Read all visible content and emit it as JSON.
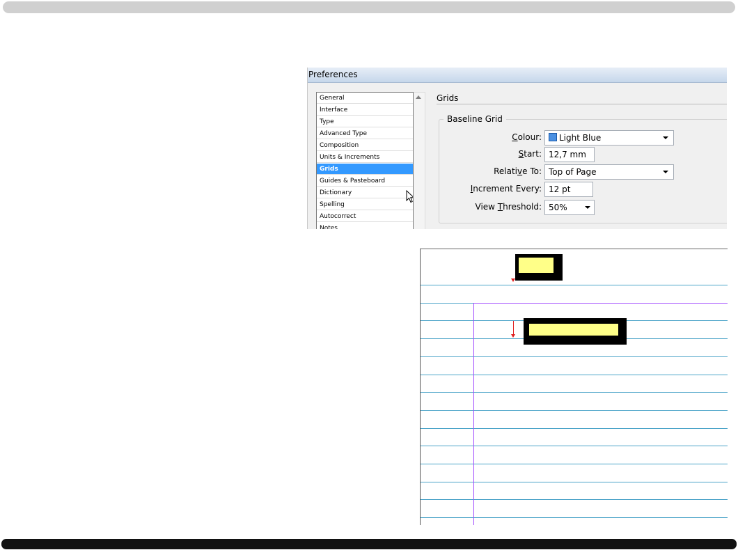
{
  "dialog": {
    "title": "Preferences",
    "categories": [
      {
        "label": "General"
      },
      {
        "label": "Interface"
      },
      {
        "label": "Type"
      },
      {
        "label": "Advanced Type"
      },
      {
        "label": "Composition"
      },
      {
        "label": "Units & Increments"
      },
      {
        "label": "Grids",
        "selected": true
      },
      {
        "label": "Guides & Pasteboard"
      },
      {
        "label": "Dictionary"
      },
      {
        "label": "Spelling"
      },
      {
        "label": "Autocorrect"
      },
      {
        "label": "Notes"
      }
    ],
    "section_title": "Grids",
    "group_title": "Baseline Grid",
    "fields": {
      "colour": {
        "prefix": "",
        "accel": "C",
        "rest": "olour:",
        "value": "Light Blue",
        "swatch_color": "#4a90e2"
      },
      "start": {
        "prefix": "",
        "accel": "S",
        "rest": "tart:",
        "value": "12,7 mm"
      },
      "relative_to": {
        "prefix": "Relati",
        "accel": "v",
        "rest": "e To:",
        "value": "Top of Page"
      },
      "increment_every": {
        "prefix": "",
        "accel": "I",
        "rest": "ncrement Every:",
        "value": "12 pt"
      },
      "view_threshold": {
        "prefix": "View ",
        "accel": "T",
        "rest": "hreshold:",
        "value": "50%"
      }
    }
  },
  "colors": {
    "selection": "#3399ff",
    "baseline_grid": "#4aa3c8",
    "margin_guide": "#a24dff",
    "callout_fill": "#ffff88",
    "arrow": "#e02020"
  }
}
